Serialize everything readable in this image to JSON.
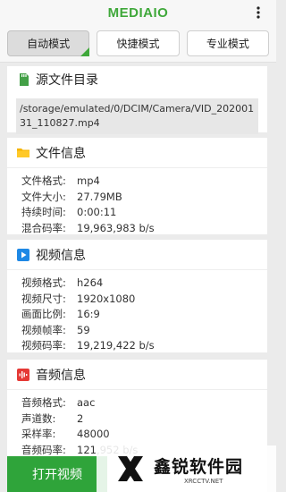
{
  "app": {
    "brand": "MEDIAIO"
  },
  "tabs": [
    {
      "label": "自动模式",
      "active": true
    },
    {
      "label": "快捷模式",
      "active": false
    },
    {
      "label": "专业模式",
      "active": false
    }
  ],
  "source": {
    "title": "源文件目录",
    "path": "/storage/emulated/0/DCIM/Camera/VID_20200131_110827.mp4"
  },
  "file_info": {
    "title": "文件信息",
    "rows": [
      {
        "k": "文件格式:",
        "v": "mp4"
      },
      {
        "k": "文件大小:",
        "v": "27.79MB"
      },
      {
        "k": "持续时间:",
        "v": "0:00:11"
      },
      {
        "k": "混合码率:",
        "v": "19,963,983 b/s"
      }
    ]
  },
  "video_info": {
    "title": "视频信息",
    "rows": [
      {
        "k": "视频格式:",
        "v": "h264"
      },
      {
        "k": "视频尺寸:",
        "v": "1920x1080"
      },
      {
        "k": "画面比例:",
        "v": "16:9"
      },
      {
        "k": "视频帧率:",
        "v": "59"
      },
      {
        "k": "视频码率:",
        "v": "19,219,422 b/s"
      }
    ]
  },
  "audio_info": {
    "title": "音频信息",
    "rows": [
      {
        "k": "音频格式:",
        "v": "aac"
      },
      {
        "k": "声道数:",
        "v": "2"
      },
      {
        "k": "采样率:",
        "v": "48000"
      },
      {
        "k": "音频码率:",
        "v": "121,952 b/s"
      }
    ]
  },
  "bottom": {
    "open_label": "打开视频"
  },
  "watermark": {
    "cn": "鑫锐软件园",
    "en": "XRCCTV.NET"
  },
  "colors": {
    "accent": "#3fa83a",
    "button": "#2fa43a"
  }
}
